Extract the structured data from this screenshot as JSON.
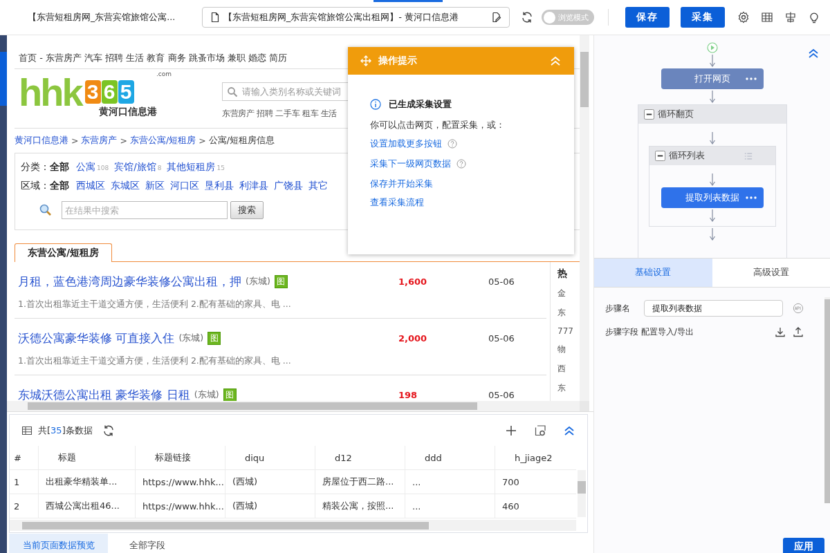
{
  "topbar": {
    "page_title": "【东营短租房网_东营宾馆旅馆公寓...",
    "url": "【东营短租房网_东营宾馆旅馆公寓出租网】- 黄河口信息港",
    "browse_mode": {
      "label": "浏览模式",
      "on": false
    },
    "buttons": [
      "保存",
      "采集"
    ]
  },
  "webpage": {
    "nav": "首页 - 东营房产 汽车 招聘 生活 教育 商务 跳蚤市场 兼职 婚恋 简历",
    "logo": {
      "letters": "hhk",
      "digits": [
        "3",
        "6",
        "5"
      ],
      "com": ".com",
      "subtitle": "黄河口信息港"
    },
    "search": {
      "placeholder": "请输入类别名称或关键词"
    },
    "hot_links": "东营房产 招聘 二手车 租车 生活",
    "breadcrumb": {
      "separator": ">",
      "items": [
        "黄河口信息港",
        "东营房产",
        "东营公寓/短租房",
        "公寓/短租房信息"
      ]
    },
    "filters": [
      {
        "label": "分类：",
        "all": "全部",
        "options": [
          {
            "text": "公寓",
            "count": "108"
          },
          {
            "text": "宾馆/旅馆",
            "count": "8"
          },
          {
            "text": "其他短租房",
            "count": "15"
          }
        ]
      },
      {
        "label": "区域：",
        "all": "全部",
        "options": [
          {
            "text": "西城区"
          },
          {
            "text": "东城区"
          },
          {
            "text": "新区"
          },
          {
            "text": "河口区"
          },
          {
            "text": "垦利县"
          },
          {
            "text": "利津县"
          },
          {
            "text": "广饶县"
          },
          {
            "text": "其它"
          }
        ]
      }
    ],
    "result_search": {
      "placeholder": "在结果中搜索",
      "button": "搜索"
    },
    "tab": "东营公寓/短租房",
    "listings": [
      {
        "title": "月租，蓝色港湾周边豪华装修公寓出租，押",
        "area": "(东城)",
        "badge": "图",
        "desc": "1.首次出租靠近主干道交通方便，生活便利 2.配有基础的家具、电 ...",
        "price": "1,600",
        "date": "05-06"
      },
      {
        "title": "沃德公寓豪华装修 可直接入住",
        "area": "(东城)",
        "badge": "图",
        "desc": "1.首次出租靠近主干道交通方便，生活便利 2.配有基础的家具、电 ...",
        "price": "2,000",
        "date": "05-06"
      },
      {
        "title": "东城沃德公寓出租 豪华装修 日租",
        "area": "(东城)",
        "badge": "图",
        "price": "198",
        "date": "05-06"
      }
    ],
    "side_column": {
      "heading": "热",
      "items": [
        "金",
        "东",
        "777",
        "物",
        "西",
        "东"
      ]
    }
  },
  "popup": {
    "title": "操作提示",
    "heading": "已生成采集设置",
    "text": "你可以点击网页，配置采集，或：",
    "links": [
      {
        "text": "设置加载更多按钮",
        "help": true
      },
      {
        "text": "采集下一级网页数据",
        "help": true
      },
      {
        "text": "保存并开始采集",
        "help": false
      },
      {
        "text": "查看采集流程",
        "help": false
      }
    ]
  },
  "data_panel": {
    "count_prefix": "共[",
    "count": "35",
    "count_suffix": "]条数据",
    "columns": [
      "#",
      "标题",
      "标题链接",
      "diqu",
      "d12",
      "ddd",
      "h_jiage2"
    ],
    "rows": [
      [
        "1",
        "出租豪华精装单...",
        "https://www.hhk...",
        "(西城)",
        "房屋位于西二路...",
        "...",
        "700"
      ],
      [
        "2",
        "西城公寓出租46...",
        "https://www.hhk...",
        "(西城)",
        "精装公寓，按照...",
        "...",
        "460"
      ]
    ],
    "tabs": [
      {
        "label": "当前页面数据预览",
        "selected": true
      },
      {
        "label": "全部字段",
        "selected": false
      }
    ]
  },
  "workflow": {
    "steps": [
      {
        "kind": "action",
        "label": "打开网页",
        "selected": false
      },
      {
        "kind": "loop",
        "label": "循环翻页",
        "expanded": true,
        "children": [
          {
            "kind": "loop",
            "label": "循环列表",
            "expanded": true,
            "children": [
              {
                "kind": "action",
                "label": "提取列表数据",
                "selected": true
              }
            ]
          }
        ]
      }
    ]
  },
  "settings": {
    "tabs": [
      {
        "label": "基础设置",
        "selected": true
      },
      {
        "label": "高级设置",
        "selected": false
      }
    ],
    "step_name": {
      "label": "步骤名",
      "value": "提取列表数据"
    },
    "fields_label": "步骤字段 配置导入/导出",
    "apply": "应用"
  }
}
